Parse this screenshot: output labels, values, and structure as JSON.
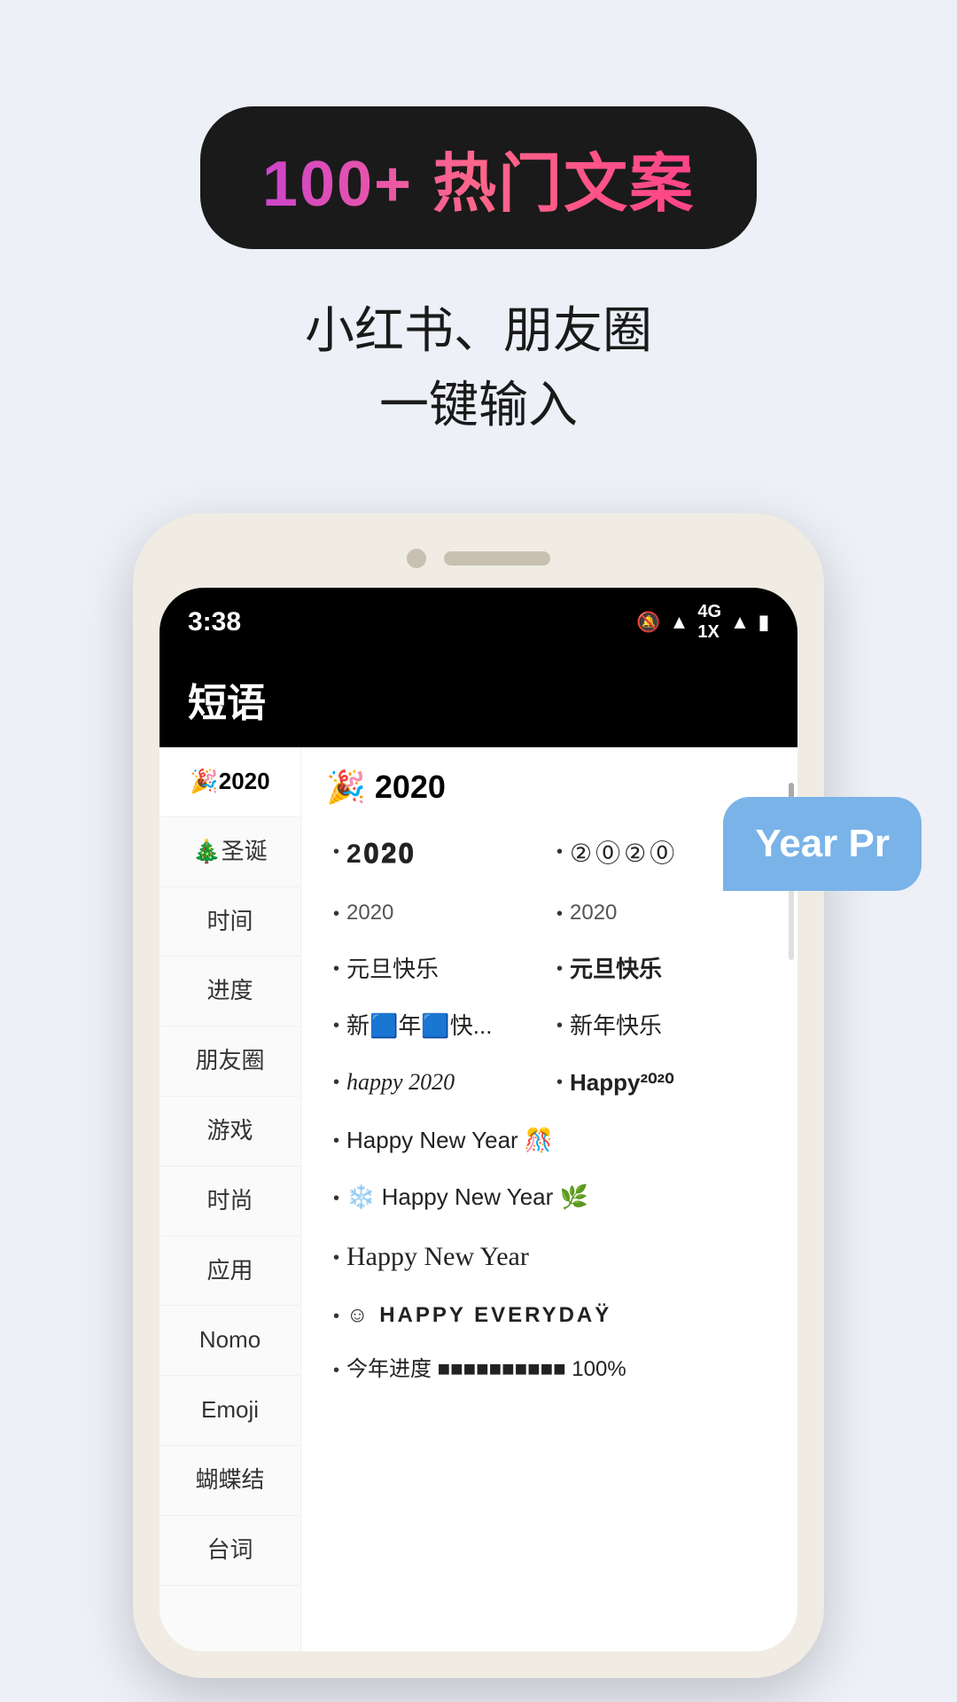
{
  "page": {
    "background": "#edf0f7"
  },
  "badge": {
    "text": "100+ 热门文案"
  },
  "subtitle": {
    "line1": "小红书、朋友圈",
    "line2": "一键输入"
  },
  "phone": {
    "status_bar": {
      "time": "3:38",
      "icons": "🔕 📶 4G 1X 📶 🔋"
    },
    "app_title": "短语",
    "sidebar_items": [
      {
        "label": "🎉2020",
        "active": true
      },
      {
        "label": "🎄圣诞",
        "active": false
      },
      {
        "label": "时间",
        "active": false
      },
      {
        "label": "进度",
        "active": false
      },
      {
        "label": "朋友圈",
        "active": false
      },
      {
        "label": "游戏",
        "active": false
      },
      {
        "label": "时尚",
        "active": false
      },
      {
        "label": "应用",
        "active": false
      },
      {
        "label": "Nomo",
        "active": false
      },
      {
        "label": "Emoji",
        "active": false
      },
      {
        "label": "蝴蝶结",
        "active": false
      },
      {
        "label": "台词",
        "active": false
      }
    ],
    "section_title": "🎉 2020",
    "content_items": [
      {
        "col": 1,
        "text": "2020",
        "style": "normal",
        "bullet": "•"
      },
      {
        "col": 2,
        "text": "②⓪②⓪",
        "style": "circled",
        "bullet": "•"
      },
      {
        "col": 1,
        "text": "2020",
        "style": "small",
        "bullet": "•"
      },
      {
        "col": 2,
        "text": "2020",
        "style": "small",
        "bullet": "•"
      },
      {
        "col": 1,
        "text": "元旦快乐",
        "style": "normal",
        "bullet": "•"
      },
      {
        "col": 2,
        "text": "元旦快乐",
        "style": "bold",
        "bullet": "•"
      },
      {
        "col": 1,
        "text": "新🟦年🟦快...",
        "style": "normal",
        "bullet": "•"
      },
      {
        "col": 2,
        "text": "新年快乐",
        "style": "normal",
        "bullet": "•"
      },
      {
        "col": 1,
        "text": "happy 2020",
        "style": "cursive",
        "bullet": "•"
      },
      {
        "col": 2,
        "text": "Happy²⁰²⁰",
        "style": "bold",
        "bullet": "•"
      },
      {
        "col": "full",
        "text": "Happy New Year 🎊",
        "style": "normal",
        "bullet": "•"
      },
      {
        "col": "full",
        "text": "❄️ Happy New Year 🌿",
        "style": "normal",
        "bullet": "•"
      },
      {
        "col": "full",
        "text": "Happy New Year",
        "style": "script",
        "bullet": "•"
      },
      {
        "col": "full",
        "text": "☺ HAPPY EVERYDAŸ",
        "style": "spaced",
        "bullet": "•"
      },
      {
        "col": "full",
        "text": "今年进度 ■■■■■■■■■■ 100%",
        "style": "progress",
        "bullet": "•"
      }
    ],
    "speech_bubble": {
      "text": "Year Pr"
    }
  }
}
